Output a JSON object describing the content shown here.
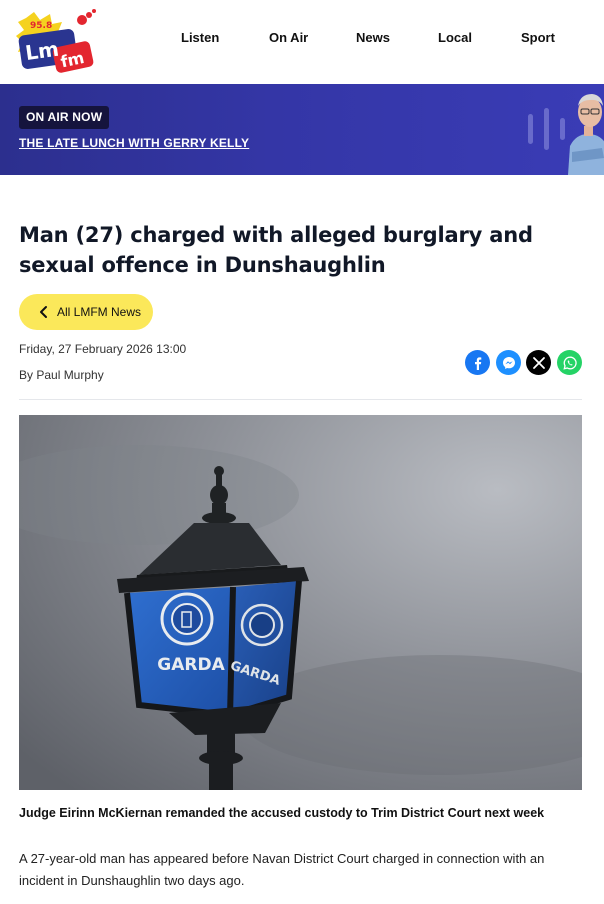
{
  "header": {
    "logo": {
      "name": "LMFM",
      "freq": "95.8",
      "text_l": "Lm",
      "text_fm": "fm"
    },
    "nav": [
      "Listen",
      "On Air",
      "News",
      "Local",
      "Sport"
    ]
  },
  "on_air": {
    "badge": "ON AIR NOW",
    "show": "THE LATE LUNCH WITH GERRY KELLY"
  },
  "article": {
    "headline_line1": "Man (27) charged with alleged burglary and",
    "headline_line2": "sexual offence in Dunshaughlin",
    "back_label": "All LMFM News",
    "date": "Friday, 27 February 2026 13:00",
    "author": "By Paul Murphy",
    "share_icons": [
      "facebook-icon",
      "messenger-icon",
      "x-icon",
      "whatsapp-icon"
    ],
    "share_colors": {
      "facebook": "#1877f2",
      "messenger": "#1e90ff",
      "x": "#000000",
      "whatsapp": "#25d366"
    },
    "image_label": "GARDA",
    "caption": "Judge Eirinn McKiernan remanded the accused  custody to Trim District Court next week",
    "body": "A 27-year-old man has appeared before Navan District Court charged in connection with an incident in Dunshaughlin two days ago."
  },
  "colors": {
    "banner": "#3436a6",
    "back_button": "#fbe85a",
    "logo_red": "#e3262f",
    "logo_blue": "#2a3590",
    "logo_yellow": "#f5d21f"
  }
}
